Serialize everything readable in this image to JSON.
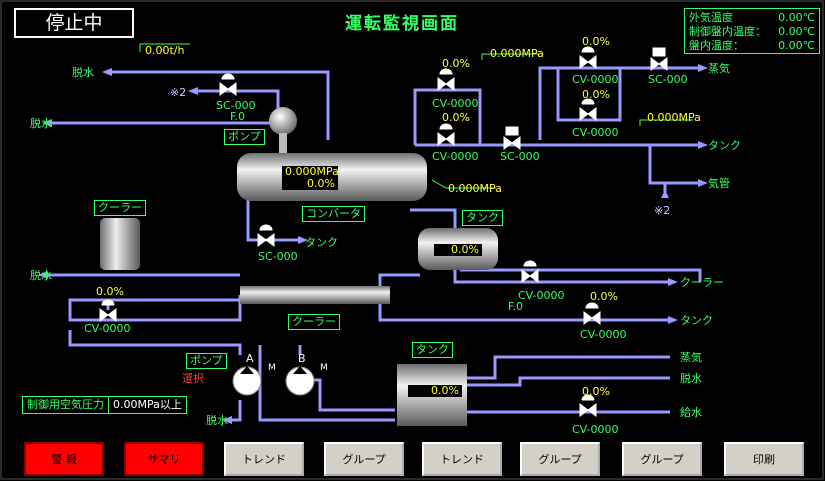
{
  "status": "停止中",
  "title": "運転監視画面",
  "weather": {
    "rows": [
      {
        "label": "外気温度",
        "value": "0.00℃"
      },
      {
        "label": "制御盤内温度：",
        "value": "0.00℃"
      },
      {
        "label": "盤内温度：",
        "value": "0.00℃"
      }
    ]
  },
  "flow": {
    "flow_rate": "0.00t/h",
    "note_left": "※2",
    "note_right": "※2"
  },
  "labels": {
    "dewater": "脱水",
    "steam": "蒸気",
    "tank": "タンク",
    "air_pipe": "気管",
    "cooler": "クーラー",
    "feedwater": "給水",
    "pump": "ポンプ",
    "converter": "コンバータ",
    "select": "選択",
    "f0": "F.0",
    "pump_a": "A",
    "pump_b": "B",
    "motor": "M"
  },
  "valves": {
    "sc1": "SC-000",
    "sc2": "SC-000",
    "sc3": "SC-000",
    "sc4": "SC-000",
    "cv1": {
      "name": "CV-0000",
      "pct": "0.0%"
    },
    "cv2": {
      "name": "CV-0000",
      "pct": "0.0%"
    },
    "cv3": {
      "name": "CV-0000",
      "pct": "0.0%"
    },
    "cv4": {
      "name": "CV-0000",
      "pct": "0.0%"
    },
    "cv5": {
      "name": "CV-0000",
      "pct": "0.0%"
    },
    "cv6": {
      "name": "CV-0000",
      "pct": "0.0%"
    },
    "cv7": {
      "name": "CV-0000",
      "pct": "0.0%"
    },
    "cv8": {
      "name": "CV-0000",
      "pct": "0.0%"
    }
  },
  "readings": {
    "p_top": "0.000MPa",
    "p_right": "0.000MPa",
    "p_conv": "0.000MPa",
    "conv_pressure": "0.000MPa",
    "conv_level": "0.0%",
    "tank1_level": "0.0%",
    "tank2_level": "0.0%"
  },
  "air_pressure": {
    "label": "制御用空気圧力",
    "value": "0.00MPa以上"
  },
  "buttons": [
    "警 報",
    "サマリ",
    "トレンド",
    "グループ",
    "トレンド",
    "グループ",
    "グループ",
    "印刷"
  ]
}
